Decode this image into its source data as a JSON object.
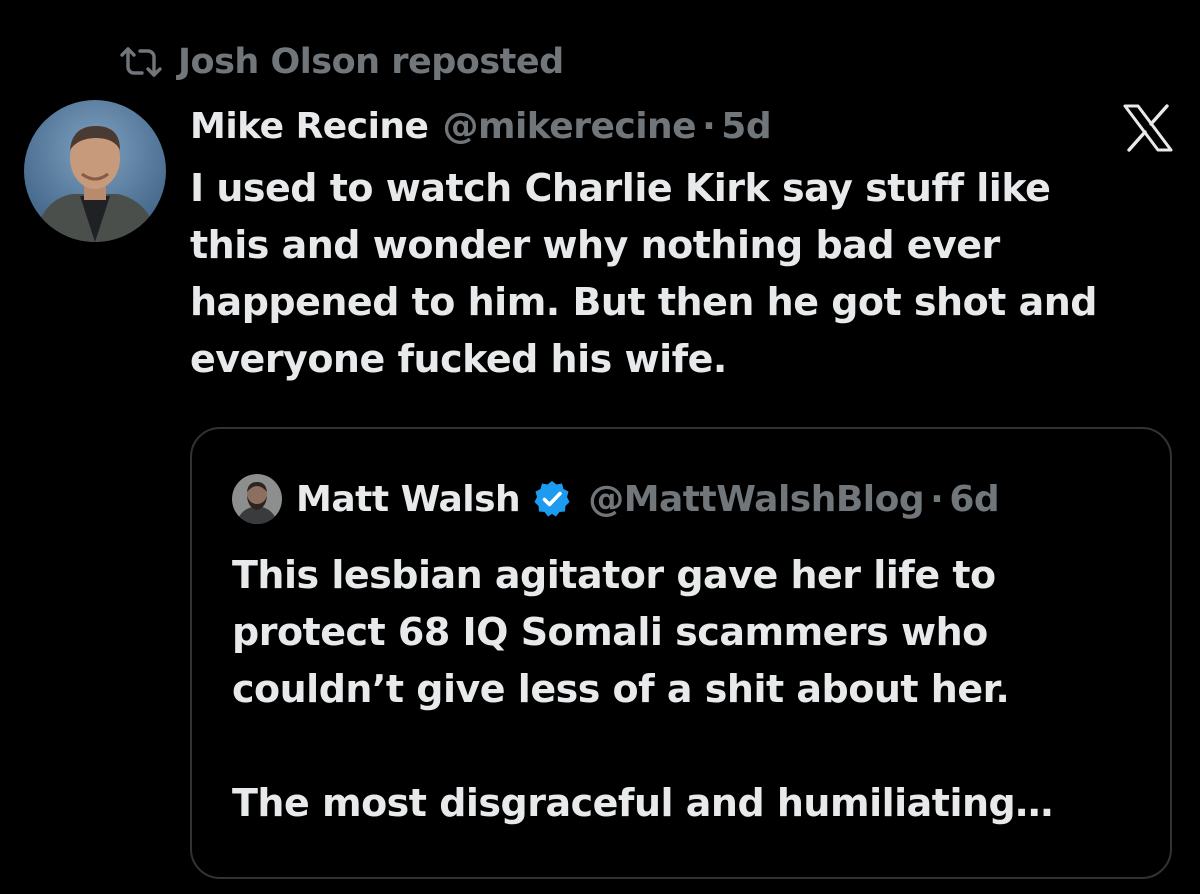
{
  "repost": {
    "label": "Josh Olson reposted",
    "icon": "repost-icon"
  },
  "post": {
    "author_name": "Mike Recine",
    "handle": "@mikerecine",
    "separator": "·",
    "time": "5d",
    "lines": [
      "I used to watch Charlie Kirk say stuff like",
      "this and wonder why nothing bad ever",
      "happened to him. But then he got shot and",
      "everyone fucked his wife."
    ],
    "brand_icon": "x-logo-icon"
  },
  "quote": {
    "author_name": "Matt Walsh",
    "verified": true,
    "handle": "@MattWalshBlog",
    "separator": "·",
    "time": "6d",
    "lines": [
      "This lesbian agitator gave her life to",
      "protect 68 IQ Somali scammers who",
      "couldn’t give less of a shit about her."
    ],
    "lines_after_break": [
      "The most disgraceful and humiliating…"
    ]
  },
  "colors": {
    "background": "#000000",
    "text_primary": "#e7e9ea",
    "text_secondary": "#71767b",
    "border": "#2f3336",
    "verified_blue": "#1d9bf0"
  }
}
